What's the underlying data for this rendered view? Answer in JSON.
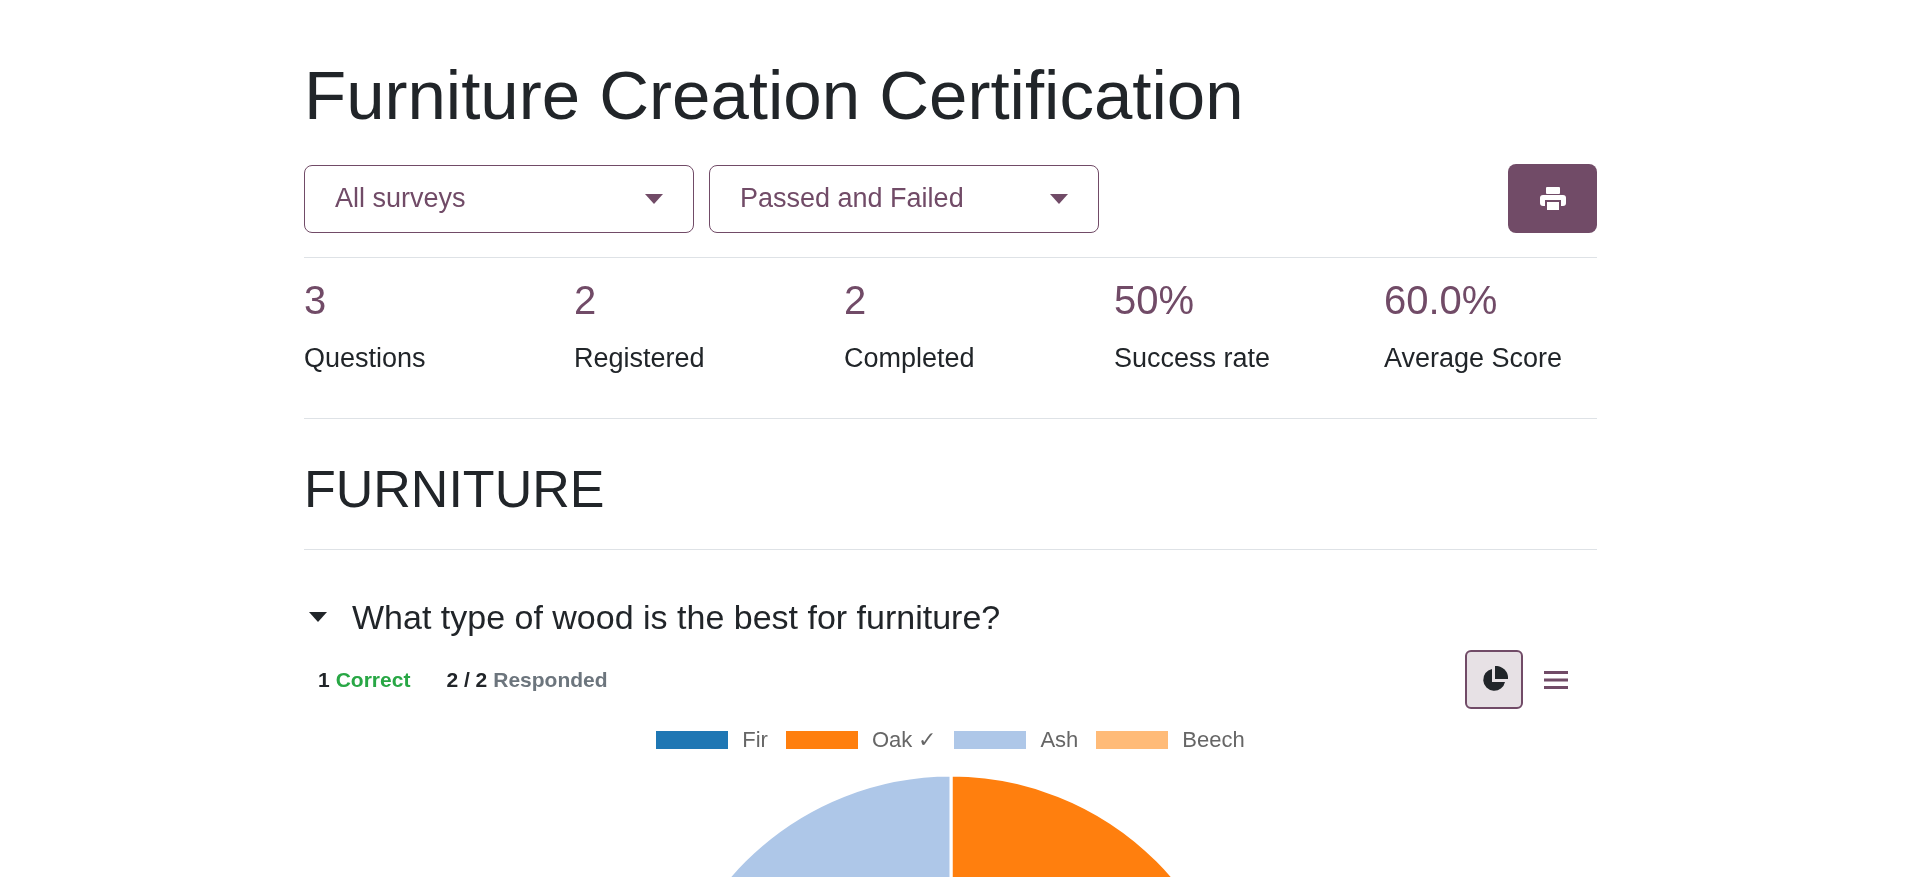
{
  "title": "Furniture Creation Certification",
  "filters": [
    {
      "value": "All surveys"
    },
    {
      "value": "Passed and Failed"
    }
  ],
  "stats": [
    {
      "value": "3",
      "label": "Questions"
    },
    {
      "value": "2",
      "label": "Registered"
    },
    {
      "value": "2",
      "label": "Completed"
    },
    {
      "value": "50%",
      "label": "Success rate"
    },
    {
      "value": "60.0%",
      "label": "Average Score"
    }
  ],
  "section": {
    "title": "FURNITURE",
    "question": {
      "text": "What type of wood is the best for furniture?",
      "expanded": true,
      "correct_count": "1",
      "correct_label": "Correct",
      "responded_count": "2 / 2",
      "responded_label": "Responded",
      "views": [
        {
          "kind": "pie",
          "selected": true
        },
        {
          "kind": "list",
          "selected": false
        }
      ],
      "chart_data": {
        "type": "pie",
        "categories": [
          "Fir",
          "Oak ✓",
          "Ash",
          "Beech"
        ],
        "values": [
          0,
          50,
          50,
          0
        ],
        "colors": [
          "#1f77b4",
          "#ff7f0e",
          "#aec7e8",
          "#ffbb78"
        ]
      }
    }
  }
}
